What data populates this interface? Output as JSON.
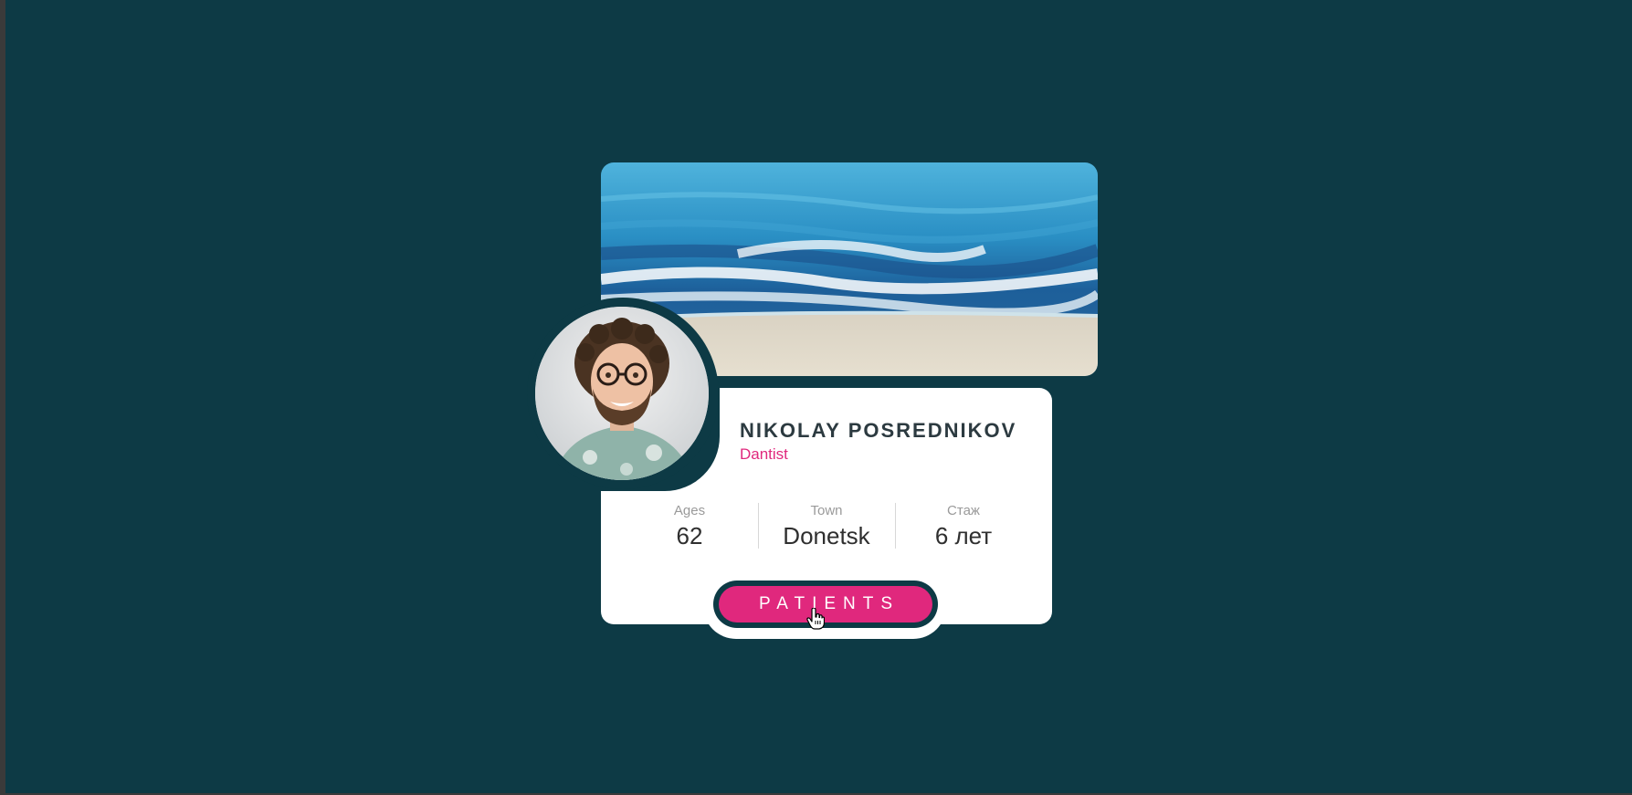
{
  "profile": {
    "name": "NIKOLAY POSREDNIKOV",
    "role": "Dantist"
  },
  "stats": [
    {
      "label": "Ages",
      "value": "62"
    },
    {
      "label": "Town",
      "value": "Donetsk"
    },
    {
      "label": "Стаж",
      "value": "6 лет"
    }
  ],
  "button": {
    "label": "PATIENTS"
  },
  "colors": {
    "background": "#0d3a45",
    "card": "#ffffff",
    "accent": "#e0287d",
    "name_text": "#2c3a40"
  },
  "icons": {
    "cursor": "hand-pointer-icon"
  }
}
